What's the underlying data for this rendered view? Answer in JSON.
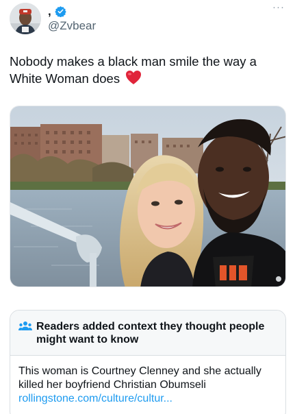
{
  "author": {
    "display_name": ",",
    "handle": "@Zvbear",
    "avatar_icon": "profile-avatar",
    "verified_icon": "verified-badge-icon",
    "verified_color": "#1d9bf0"
  },
  "tweet": {
    "text": "Nobody makes a black man smile the way a White Woman does",
    "emoji_icon": "red-heart-icon"
  },
  "media": {
    "type": "photo",
    "icon": "couple-selfie-photo"
  },
  "community_note": {
    "title": "Readers added context they thought people might want to know",
    "body": "This woman is Courtney Clenney and she actually killed her boyfriend Christian Obumseli",
    "link": "rollingstone.com/culture/cultur...",
    "icon": "people-icon",
    "accent_color": "#1d9bf0"
  },
  "colors": {
    "text": "#0f1419",
    "secondary": "#536471",
    "link": "#1d9bf0"
  }
}
